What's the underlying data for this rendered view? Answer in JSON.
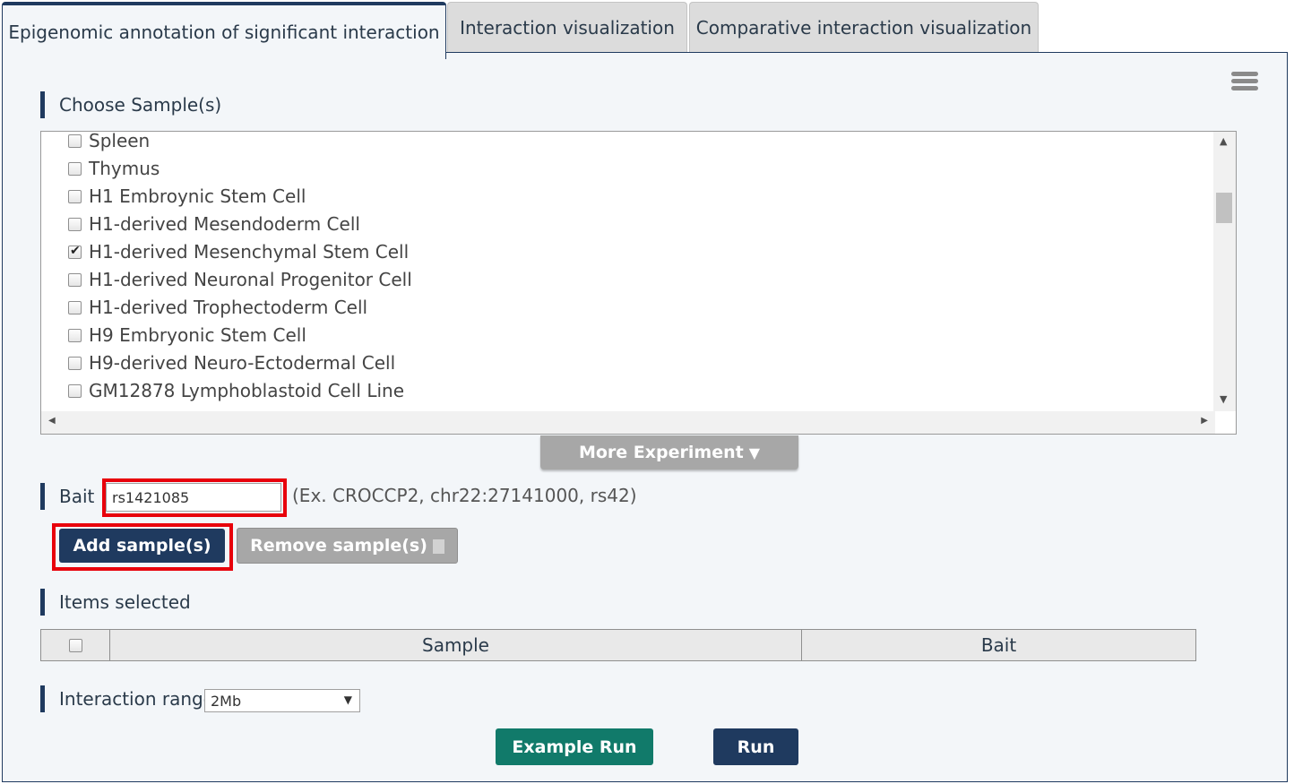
{
  "tabs": [
    {
      "label": "Epigenomic annotation of significant interaction",
      "active": true
    },
    {
      "label": "Interaction visualization",
      "active": false
    },
    {
      "label": "Comparative interaction visualization",
      "active": false
    }
  ],
  "choose_samples": {
    "label": "Choose Sample(s)",
    "items": [
      {
        "label": "Spleen",
        "checked": false
      },
      {
        "label": "Thymus",
        "checked": false
      },
      {
        "label": "H1 Embroynic Stem Cell",
        "checked": false
      },
      {
        "label": "H1-derived Mesendoderm Cell",
        "checked": false
      },
      {
        "label": "H1-derived Mesenchymal Stem Cell",
        "checked": true
      },
      {
        "label": "H1-derived Neuronal Progenitor Cell",
        "checked": false
      },
      {
        "label": "H1-derived Trophectoderm Cell",
        "checked": false
      },
      {
        "label": "H9 Embryonic Stem Cell",
        "checked": false
      },
      {
        "label": "H9-derived Neuro-Ectodermal Cell",
        "checked": false
      },
      {
        "label": "GM12878 Lymphoblastoid Cell Line",
        "checked": false
      }
    ]
  },
  "more_experiment": {
    "label": "More Experiment",
    "icon": "caret-down-icon"
  },
  "bait": {
    "label": "Bait :",
    "value": "rs1421085",
    "hint": "(Ex. CROCCP2, chr22:27141000, rs42)"
  },
  "buttons": {
    "add": "Add sample(s)",
    "remove": "Remove sample(s)",
    "example_run": "Example Run",
    "run": "Run"
  },
  "items_selected": {
    "label": "Items selected",
    "columns": [
      "Sample",
      "Bait"
    ]
  },
  "interaction_range": {
    "label": "Interaction range",
    "selected": "2Mb"
  },
  "colors": {
    "navy": "#1f3a5f",
    "teal": "#117a6a",
    "gray_button": "#a7a7a7",
    "highlight_red": "#e8000b",
    "panel_bg": "#f3f6f9"
  }
}
